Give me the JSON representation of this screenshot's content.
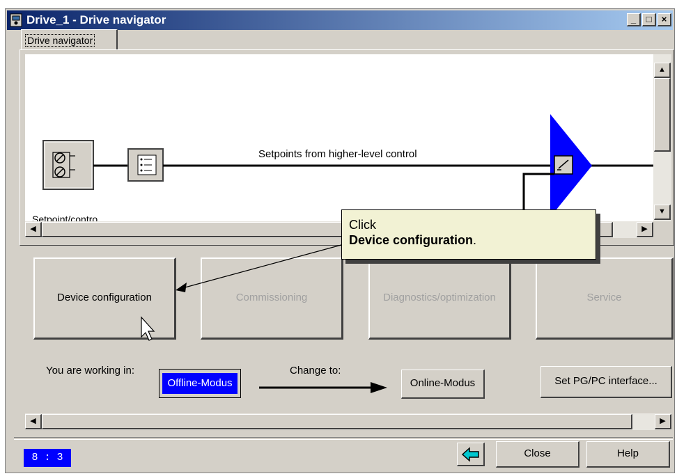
{
  "window": {
    "title": "Drive_1 - Drive navigator",
    "controls": {
      "minimize": "_",
      "maximize": "□",
      "close": "×"
    }
  },
  "tab": {
    "label": "Drive navigator"
  },
  "diagram": {
    "setpoint_line_label": "Setpoints from higher-level control",
    "block_caption": "Setpoint/contro"
  },
  "callout": {
    "line1": "Click",
    "line2": "Device configuration",
    "line2_suffix": "."
  },
  "actions": {
    "device_configuration": "Device configuration",
    "commissioning": "Commissioning",
    "diagnostics": "Diagnostics/optimization",
    "service": "Service"
  },
  "mode": {
    "working_in_label": "You are working in:",
    "current_mode": "Offline-Modus",
    "change_to_label": "Change to:",
    "target_mode": "Online-Modus",
    "pg_pc_button": "Set PG/PC interface..."
  },
  "footer": {
    "status_code": "8 : 3",
    "close_label": "Close",
    "help_label": "Help",
    "back_icon": "back-arrow-icon"
  },
  "colors": {
    "accent": "#0000ff",
    "callout_bg": "#f2f2d4",
    "title_start": "#0a246a",
    "title_end": "#a6caf0"
  }
}
